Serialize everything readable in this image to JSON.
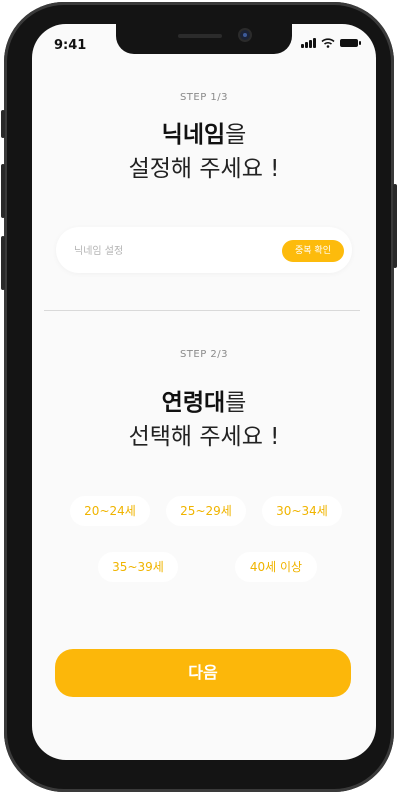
{
  "status_bar": {
    "time": "9:41"
  },
  "step1": {
    "label": "STEP 1/3",
    "title_bold": "닉네임",
    "title_rest": "을",
    "title_line2": "설정해 주세요 !",
    "nickname_placeholder": "닉네임 설정",
    "nickname_value": "",
    "check_button": "중복 확인"
  },
  "step2": {
    "label": "STEP 2/3",
    "title_bold": "연령대",
    "title_rest": "를",
    "title_line2": "선택해 주세요 !",
    "age_options": [
      "20~24세",
      "25~29세",
      "30~34세",
      "35~39세",
      "40세 이상"
    ]
  },
  "next_button": "다음",
  "colors": {
    "accent": "#fcb70a",
    "chip_text": "#f0b400",
    "background": "#fafafa"
  }
}
